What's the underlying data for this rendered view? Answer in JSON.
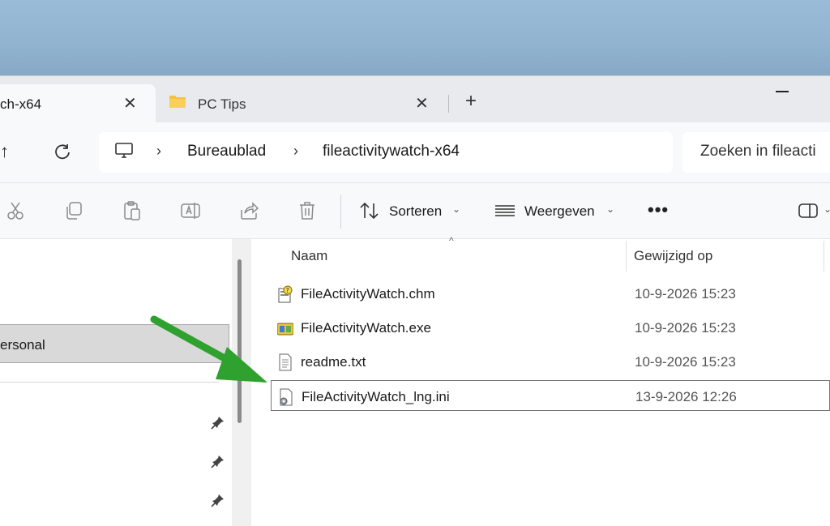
{
  "window": {
    "tabs": [
      {
        "label": "ch-x64",
        "active": true
      },
      {
        "label": "PC Tips",
        "active": false
      }
    ]
  },
  "address": {
    "breadcrumbs": [
      "Bureaublad",
      "fileactivitywatch-x64"
    ]
  },
  "search": {
    "placeholder": "Zoeken in fileacti"
  },
  "toolbar": {
    "sort_label": "Sorteren",
    "view_label": "Weergeven",
    "more_label": "•••"
  },
  "sidebar": {
    "selected_label": "ersonal"
  },
  "filelist": {
    "columns": [
      "Naam",
      "Gewijzigd op"
    ],
    "rows": [
      {
        "name": "FileActivityWatch.chm",
        "modified": "10-9-2026 15:23",
        "icon": "help-file-icon"
      },
      {
        "name": "FileActivityWatch.exe",
        "modified": "10-9-2026 15:23",
        "icon": "exe-icon"
      },
      {
        "name": "readme.txt",
        "modified": "10-9-2026 15:23",
        "icon": "text-file-icon"
      },
      {
        "name": "FileActivityWatch_lng.ini",
        "modified": "13-9-2026 12:26",
        "icon": "settings-file-icon",
        "selected": true
      }
    ]
  },
  "colors": {
    "accent_arrow": "#2fa12f",
    "folder": "#f4c141"
  }
}
